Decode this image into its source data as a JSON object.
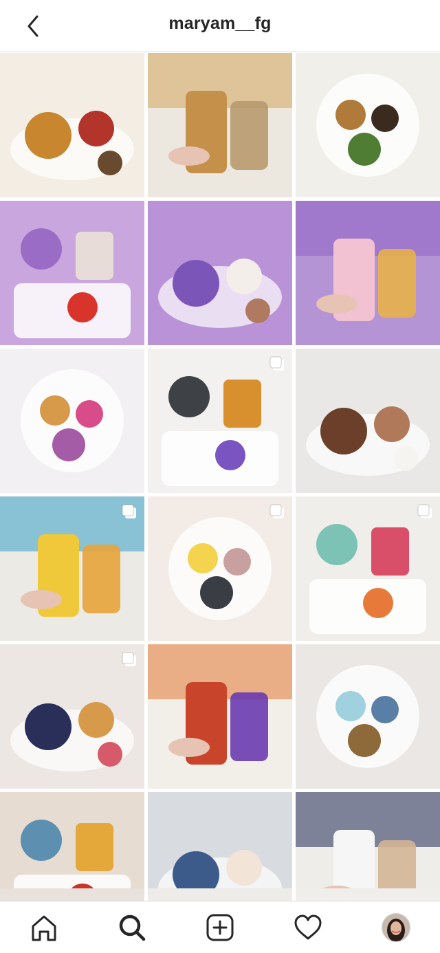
{
  "header": {
    "username": "maryam__fg",
    "back_icon": "chevron-left-icon"
  },
  "grid": {
    "tiles": [
      {
        "bg": "#f3ede4",
        "a": "#c8862e",
        "b": "#b3342a",
        "c": "#6a4a2e",
        "multi": false
      },
      {
        "bg": "#ece7df",
        "a": "#d7a75f",
        "b": "#c4904a",
        "c": "#b89a6f",
        "multi": false
      },
      {
        "bg": "#f1efe9",
        "a": "#b07a3a",
        "b": "#3b2a1e",
        "c": "#4f7d33",
        "multi": false
      },
      {
        "bg": "#c9a6de",
        "a": "#9a6cc6",
        "b": "#e8dcd8",
        "c": "#d9342b",
        "multi": false
      },
      {
        "bg": "#b992d8",
        "a": "#7c55b8",
        "b": "#f3eee9",
        "c": "#b07a60",
        "multi": false
      },
      {
        "bg": "#b594d6",
        "a": "#8e63c4",
        "b": "#f3c2d2",
        "c": "#e7b04a",
        "multi": false
      },
      {
        "bg": "#f2f0f2",
        "a": "#d79a4a",
        "b": "#d84c8a",
        "c": "#a55ca7",
        "multi": false
      },
      {
        "bg": "#f2f1ef",
        "a": "#3e4247",
        "b": "#d8902e",
        "c": "#7a55c2",
        "multi": true
      },
      {
        "bg": "#e9e8e6",
        "a": "#6b3f2a",
        "b": "#b07a5a",
        "c": "#f6f4f0",
        "multi": false
      },
      {
        "bg": "#eceae4",
        "a": "#3aa0c9",
        "b": "#f0c93a",
        "c": "#e7a43b",
        "multi": true
      },
      {
        "bg": "#f3ece6",
        "a": "#f4d44e",
        "b": "#c9a0a0",
        "c": "#3a3d44",
        "multi": true
      },
      {
        "bg": "#efeeea",
        "a": "#7cc3b5",
        "b": "#d94f6a",
        "c": "#e77a3a",
        "multi": true
      },
      {
        "bg": "#ede7e4",
        "a": "#2a2f5a",
        "b": "#d69a4a",
        "c": "#d65a6a",
        "multi": true
      },
      {
        "bg": "#f2eee8",
        "a": "#e27a35",
        "b": "#c8452b",
        "c": "#6a3bb0",
        "multi": false
      },
      {
        "bg": "#eae7e4",
        "a": "#9fd1df",
        "b": "#5a7fa6",
        "c": "#8e6a3a",
        "multi": false
      },
      {
        "bg": "#e6dcd2",
        "a": "#5c8fb0",
        "b": "#e3a73a",
        "c": "#c7342a",
        "multi": false
      },
      {
        "bg": "#d8dbe0",
        "a": "#3c5a8a",
        "b": "#f2e5d8",
        "c": "#e07a9a",
        "multi": false
      },
      {
        "bg": "#efedea",
        "a": "#1f2a55",
        "b": "#f6f6f6",
        "c": "#d4b596",
        "multi": false
      }
    ],
    "peek": [
      "#e8e1dc",
      "#eeece8",
      "#f0eeeb"
    ]
  },
  "nav": {
    "items": [
      {
        "name": "home",
        "icon": "home-icon"
      },
      {
        "name": "search",
        "icon": "search-icon"
      },
      {
        "name": "new-post",
        "icon": "add-post-icon"
      },
      {
        "name": "activity",
        "icon": "heart-icon"
      },
      {
        "name": "profile",
        "icon": "profile-avatar"
      }
    ]
  }
}
